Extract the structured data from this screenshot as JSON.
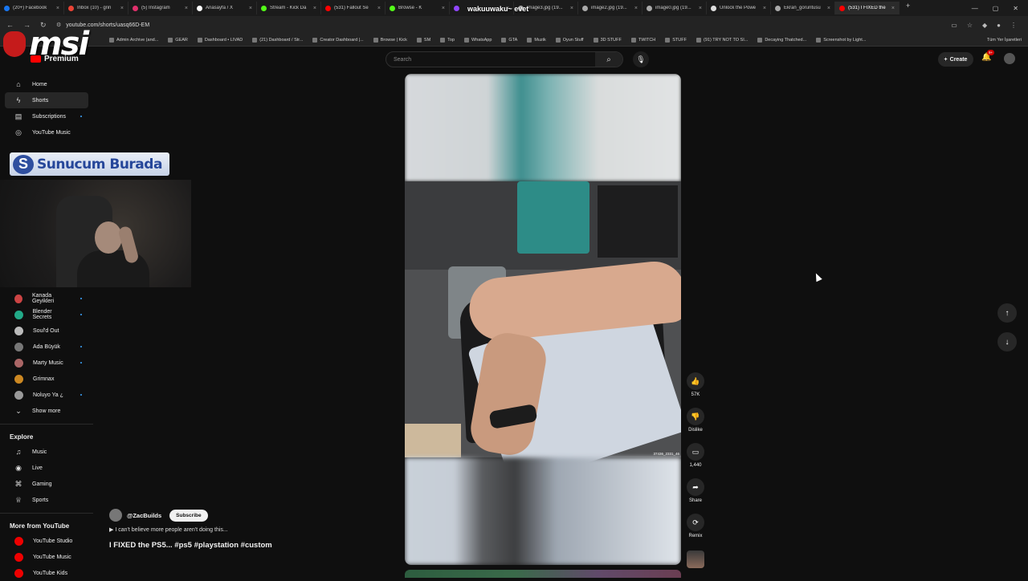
{
  "tabs": [
    {
      "title": "(20+) Facebook",
      "color": "#1877f2"
    },
    {
      "title": "Inbox (10) - grin",
      "color": "#ea4335"
    },
    {
      "title": "(5) Instagram",
      "color": "#e1306c"
    },
    {
      "title": "Anasayfa / X",
      "color": "#ffffff"
    },
    {
      "title": "Stream - Kick Da",
      "color": "#53fc18"
    },
    {
      "title": "(531) Fallout Se",
      "color": "#ff0000"
    },
    {
      "title": "Browse - K",
      "color": "#53fc18"
    },
    {
      "title": "",
      "color": "#9146ff"
    },
    {
      "title": "image3.jpg (19...",
      "color": "#aaaaaa"
    },
    {
      "title": "image2.jpg (19...",
      "color": "#aaaaaa"
    },
    {
      "title": "image0.jpg (19...",
      "color": "#aaaaaa"
    },
    {
      "title": "Unlock the Powe",
      "color": "#dddddd"
    },
    {
      "title": "Ekran_goruntusu",
      "color": "#aaaaaa"
    },
    {
      "title": "(531) I FIXED the",
      "color": "#ff0000"
    }
  ],
  "overlay_text": "wakuuwaku~ evet",
  "address": {
    "url": "youtube.com/shorts/uasq66D-EM"
  },
  "bookmarks": [
    "Admin Archive (and...",
    "GEAR",
    "Dashboard • LIVAD",
    "(21) Dashboard / Str...",
    "Creator Dashboard |...",
    "Browse | Kick",
    "SM",
    "Top",
    "WhatsApp",
    "GTA",
    "Muzik",
    "Oyun Stuff",
    "3D STUFF",
    "TWITCH",
    "STUFF",
    "(91) TRY NOT TO SI...",
    "Decaying Thatched...",
    "Screenshot by Light..."
  ],
  "bookmarks_right": "Tüm Yer İşaretleri",
  "logo": {
    "msi": "msi",
    "premium": "Premium"
  },
  "search": {
    "placeholder": "Search"
  },
  "create_label": "Create",
  "notif_badge": "9+",
  "nav": [
    {
      "label": "Home",
      "icon": "⌂"
    },
    {
      "label": "Shorts",
      "icon": "ϟ"
    },
    {
      "label": "Subscriptions",
      "icon": "▤"
    },
    {
      "label": "YouTube Music",
      "icon": "◎"
    }
  ],
  "banner": {
    "letter": "S",
    "text": "Sunucum Burada"
  },
  "subscriptions": [
    {
      "label": "Kanada Geyikleri",
      "color": "#c44"
    },
    {
      "label": "Blender Secrets",
      "color": "#2a8"
    },
    {
      "label": "Soul'd Out",
      "color": "#bbb"
    },
    {
      "label": "Ada Büyük",
      "color": "#777"
    },
    {
      "label": "Marty Music",
      "color": "#a66"
    },
    {
      "label": "Grimnax",
      "color": "#c82"
    },
    {
      "label": "Noluyo Ya ¿",
      "color": "#999"
    }
  ],
  "show_more": "Show more",
  "explore": {
    "title": "Explore",
    "items": [
      {
        "label": "Music",
        "icon": "♫"
      },
      {
        "label": "Live",
        "icon": "◉"
      },
      {
        "label": "Gaming",
        "icon": "⌘"
      },
      {
        "label": "Sports",
        "icon": "♕"
      }
    ]
  },
  "more_from": {
    "title": "More from YouTube",
    "items": [
      "YouTube Studio",
      "YouTube Music",
      "YouTube Kids"
    ]
  },
  "video": {
    "watermark": "37436_2331_46",
    "channel": "@ZacBuilds",
    "subscribe": "Subscribe",
    "description": "▶ I can't believe more people aren't doing this...",
    "title": "I FIXED the PS5... #ps5 #playstation #custom"
  },
  "actions": [
    {
      "icon": "👍",
      "label": "57K"
    },
    {
      "icon": "👎",
      "label": "Dislike"
    },
    {
      "icon": "▭",
      "label": "1,440"
    },
    {
      "icon": "➦",
      "label": "Share"
    },
    {
      "icon": "⟳",
      "label": "Remix"
    }
  ]
}
